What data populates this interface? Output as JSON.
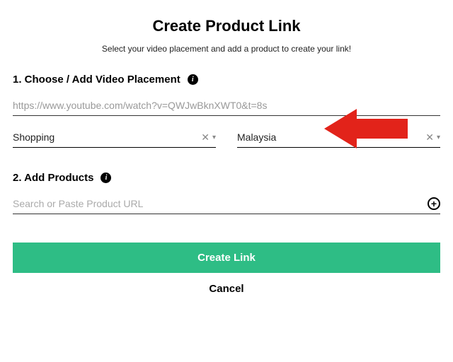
{
  "title": "Create Product Link",
  "subtitle": "Select your video placement and add a product to create your link!",
  "section1": {
    "label": "1. Choose / Add Video Placement",
    "url_value": "https://www.youtube.com/watch?v=QWJwBknXWT0&t=8s",
    "category_value": "Shopping",
    "region_value": "Malaysia"
  },
  "section2": {
    "label": "2. Add Products",
    "search_placeholder": "Search or Paste Product URL"
  },
  "buttons": {
    "create": "Create Link",
    "cancel": "Cancel"
  },
  "colors": {
    "primary": "#2ebd85",
    "arrow": "#e2231a"
  }
}
